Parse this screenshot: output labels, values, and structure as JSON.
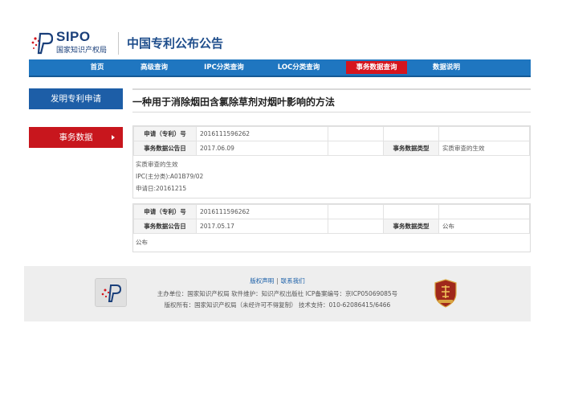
{
  "header": {
    "logo_en": "SIPO",
    "logo_cn": "国家知识产权局",
    "site_title": "中国专利公布公告"
  },
  "nav": {
    "items": [
      {
        "label": "首页"
      },
      {
        "label": "高级查询"
      },
      {
        "label": "IPC分类查询"
      },
      {
        "label": "LOC分类查询"
      },
      {
        "label": "事务数据查询",
        "active": true
      },
      {
        "label": "数据说明"
      }
    ],
    "active_color": "#d5151e",
    "bar_color": "#1f76c0"
  },
  "sidebar": {
    "invention_btn": "发明专利申请",
    "transaction_btn": "事务数据"
  },
  "main": {
    "title": "一种用于消除烟田含氯除草剂对烟叶影响的方法",
    "records": [
      {
        "app_no_label": "申请（专利）号",
        "app_no": "2016111596262",
        "date_label": "事务数据公告日",
        "date": "2017.06.09",
        "type_label": "事务数据类型",
        "type": "实质审查的生效",
        "details": [
          "实质审查的生效",
          "IPC(主分类):A01B79/02",
          "申请日:20161215"
        ]
      },
      {
        "app_no_label": "申请（专利）号",
        "app_no": "2016111596262",
        "date_label": "事务数据公告日",
        "date": "2017.05.17",
        "type_label": "事务数据类型",
        "type": "公布",
        "details": [
          "公布"
        ]
      }
    ]
  },
  "footer": {
    "link_copyright": "版权声明",
    "link_separator": "|",
    "link_contact": "联系我们",
    "line1": "主办单位：国家知识产权局   软件维护：知识产权出版社   ICP备案编号：京ICP05069085号",
    "line2": "版权所有：国家知识产权局（未经许可不得复制）   技术支持：010-62086415/6466"
  }
}
